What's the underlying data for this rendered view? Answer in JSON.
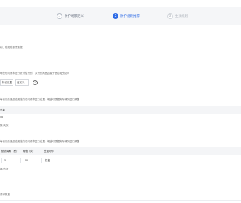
{
  "steps": [
    {
      "num": "✓",
      "label": "防护场景定义"
    },
    {
      "num": "2",
      "label": "防护规则推荐"
    },
    {
      "num": "3",
      "label": "生效规则"
    }
  ],
  "intro": "刷、防爬防恶意数据",
  "desc1": "哪些访问请求进行针对性识别，以识别其是否属于恶意爬虫访问",
  "btn_mark": "标识设置",
  "btn_custom": "自定义",
  "help": "?",
  "desc2": "每访问总量超过阈值的访问请求进行处置，阈值可根据实际情况进行调整",
  "t1_header": "总数",
  "t1_value": "45",
  "t1_unit": "数/天次",
  "desc3": "每访问总量超过阈值的访问请求进行处置，阈值可根据实际情况进行调整",
  "t2_headers": [
    "统计周期（秒）",
    "阈值（次）",
    "处置动作"
  ],
  "t2_values": [
    "20",
    "30",
    "拦截"
  ],
  "t2_note": "数/秒次",
  "footer": "请求数量"
}
